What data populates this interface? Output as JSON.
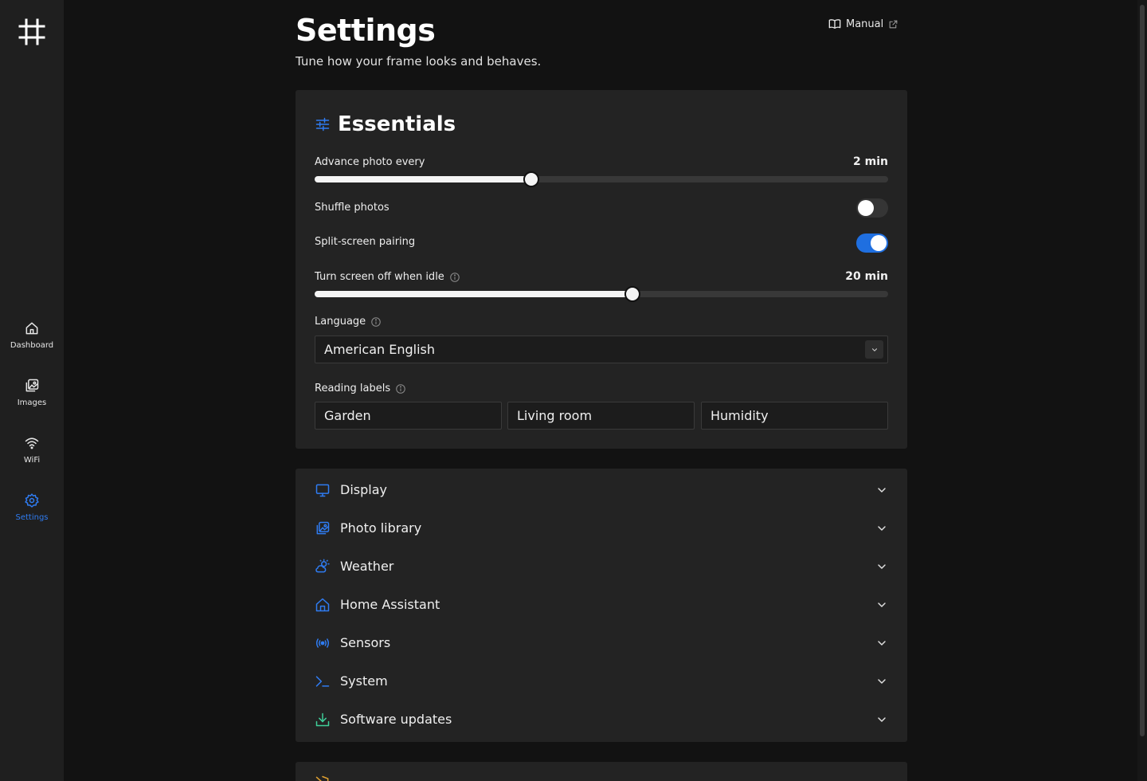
{
  "header": {
    "title": "Settings",
    "subtitle": "Tune how your frame looks and behaves.",
    "manual_label": "Manual"
  },
  "sidebar": {
    "logo_icon": "frame-icon",
    "items": [
      {
        "label": "Dashboard",
        "icon": "home-icon",
        "active": false
      },
      {
        "label": "Images",
        "icon": "images-icon",
        "active": false
      },
      {
        "label": "WiFi",
        "icon": "wifi-icon",
        "active": false
      },
      {
        "label": "Settings",
        "icon": "gear-icon",
        "active": true
      }
    ]
  },
  "essentials": {
    "title": "Essentials",
    "advance": {
      "label": "Advance photo every",
      "value": "2 min",
      "fraction": 0.378
    },
    "shuffle": {
      "label": "Shuffle photos",
      "enabled": false
    },
    "split_screen": {
      "label": "Split-screen pairing",
      "enabled": true
    },
    "screen_off": {
      "label": "Turn screen off when idle",
      "value": "20 min",
      "fraction": 0.554
    },
    "language": {
      "label": "Language",
      "value": "American English"
    },
    "reading_labels": {
      "label": "Reading labels",
      "values": [
        "Garden",
        "Living room",
        "Humidity"
      ]
    }
  },
  "sections": [
    {
      "label": "Display",
      "icon": "monitor-icon"
    },
    {
      "label": "Photo library",
      "icon": "photo-library-icon"
    },
    {
      "label": "Weather",
      "icon": "weather-icon"
    },
    {
      "label": "Home Assistant",
      "icon": "home-assistant-icon"
    },
    {
      "label": "Sensors",
      "icon": "sensors-icon"
    },
    {
      "label": "System",
      "icon": "terminal-icon"
    },
    {
      "label": "Software updates",
      "icon": "download-icon"
    }
  ],
  "colors": {
    "accent": "#2f7cf2",
    "background": "#121212",
    "sidebar": "#1f1f1f",
    "card": "#232323",
    "update_icon": "#3fcf9a",
    "security_icon": "#e0a030"
  }
}
